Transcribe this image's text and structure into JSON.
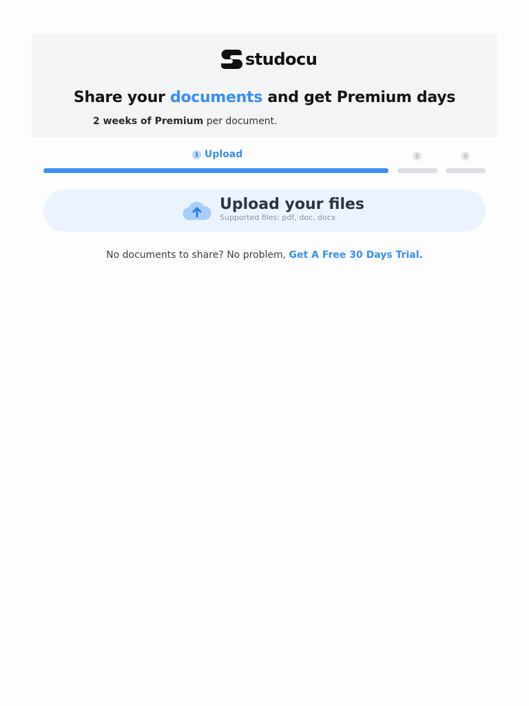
{
  "brand": {
    "name": "studocu",
    "logo_icon": "studocu-s-logo"
  },
  "header": {
    "headline_pre": "Share your ",
    "headline_accent": "documents",
    "headline_post": " and get Premium days",
    "sub_bold": "2 weeks of Premium",
    "sub_rest": " per document."
  },
  "steps": {
    "items": [
      {
        "number": "1",
        "label": "Upload",
        "state": "active"
      },
      {
        "number": "2",
        "label": "",
        "state": "inactive"
      },
      {
        "number": "3",
        "label": "",
        "state": "inactive"
      }
    ]
  },
  "upload": {
    "icon": "cloud-upload-icon",
    "title": "Upload your files",
    "subtitle": "Supported files: pdf, doc, docx"
  },
  "trial": {
    "text": "No documents to share? No problem, ",
    "link": "Get A Free 30 Days Trial."
  },
  "colors": {
    "accent": "#3b8ef0",
    "header_bg": "#f3f4f6",
    "upload_bg": "#eaf3fe"
  }
}
